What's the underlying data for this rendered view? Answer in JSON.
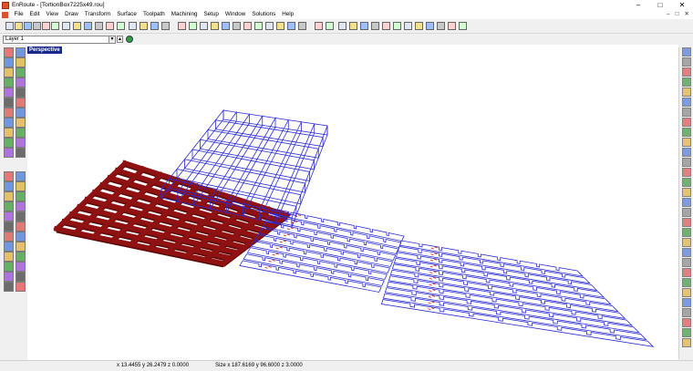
{
  "window": {
    "title": "EnRoute - [TortionBox7225x49.rou]",
    "controls": [
      "minimize",
      "maximize",
      "close"
    ]
  },
  "menu": {
    "items": [
      "File",
      "Edit",
      "View",
      "Draw",
      "Transform",
      "Surface",
      "Toolpath",
      "Machining",
      "Setup",
      "Window",
      "Solutions",
      "Help"
    ]
  },
  "layer": {
    "current": "Layer 1"
  },
  "viewport": {
    "label": "Perspective"
  },
  "status": {
    "coordinates": "x 13.4455 y 26.2479 z 0.0000",
    "size": "Size x 187.6169 y 96.6000 z 3.0000"
  },
  "colors": {
    "grid_solid": "#8f1111",
    "wire": "#2b2bd6",
    "wire_labels": "#d01818"
  },
  "toolbar": {
    "icons": [
      "new-file-icon",
      "open-file-icon",
      "save-icon",
      "print-icon",
      "print-preview-icon",
      "cut-icon",
      "copy-icon",
      "paste-icon",
      "undo-icon",
      "redo-icon",
      "zoom-window-icon",
      "zoom-in-icon",
      "zoom-out-icon",
      "zoom-all-icon",
      "pan-icon",
      "view-top-icon",
      "view-front-icon",
      "view-right-icon",
      "view-3d-icon",
      "render-icon",
      "shade-icon",
      "layer-icon",
      "grid-icon",
      "snap-icon"
    ]
  }
}
